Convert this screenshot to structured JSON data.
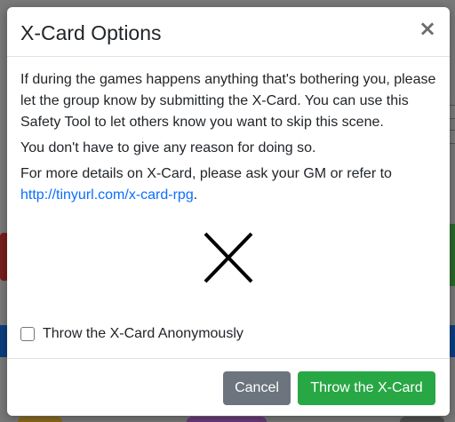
{
  "modal": {
    "title": "X-Card Options",
    "close_icon": "×",
    "paragraphs": [
      "If during the games happens anything that's bothering you, please let the group know by submitting the X-Card. You can use this Safety Tool to let others know you want to skip this scene.",
      "You don't have to give any reason for doing so."
    ],
    "details_prefix": "For more details on X-Card, please ask your GM or refer to ",
    "details_link": "http://tinyurl.com/x-card-rpg",
    "details_suffix": ".",
    "x_symbol_icon": "x-card-symbol",
    "checkbox_label": "Throw the X-Card Anonymously",
    "checkbox_checked": false
  },
  "footer": {
    "cancel_label": "Cancel",
    "throw_label": "Throw the X-Card"
  },
  "colors": {
    "primary_link": "#0d6efd",
    "cancel_bg": "#6c757d",
    "throw_bg": "#28a745"
  }
}
